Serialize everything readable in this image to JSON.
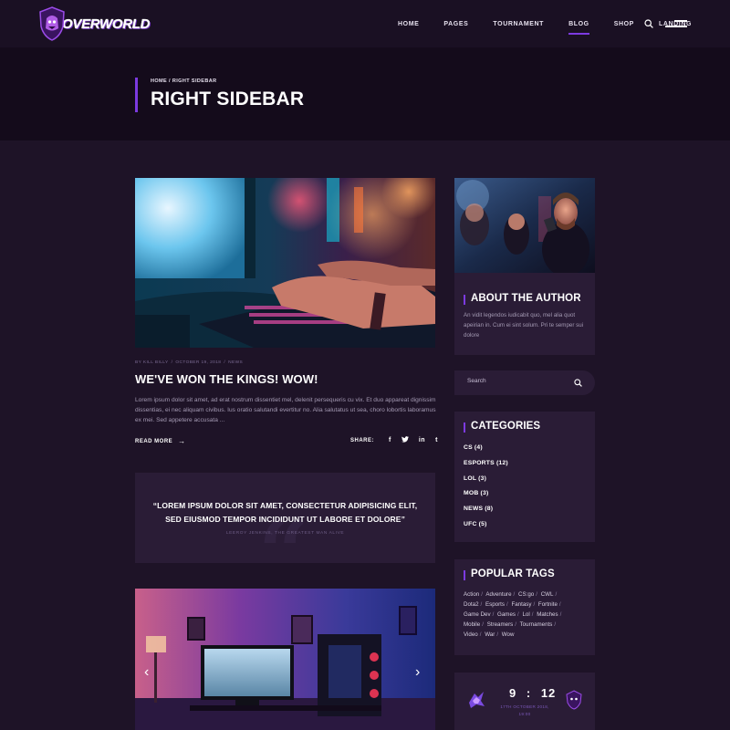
{
  "brand": {
    "name": "OVERWORLD",
    "accent": "#7c3ae0"
  },
  "nav": {
    "items": [
      {
        "label": "HOME",
        "active": false
      },
      {
        "label": "PAGES",
        "active": false
      },
      {
        "label": "TOURNAMENT",
        "active": false
      },
      {
        "label": "BLOG",
        "active": true
      },
      {
        "label": "SHOP",
        "active": false
      },
      {
        "label": "LANDING",
        "active": false
      }
    ],
    "search_icon": "search-icon",
    "menu_icon": "hamburger-icon"
  },
  "header": {
    "breadcrumb": "HOME / RIGHT SIDEBAR",
    "title": "RIGHT SIDEBAR"
  },
  "post": {
    "author": "BY KILL BILLY",
    "date": "OCTOBER 19, 2018",
    "category": "NEWS",
    "title": "WE'VE WON THE KINGS! WOW!",
    "excerpt": "Lorem ipsum dolor sit amet, ad erat nostrum dissentiet mel, delenit persequeris cu vix. Et duo appareat dignissim dissentias, ei nec aliquam civibus. Ius oratio salutandi evertitur no. Alia salutatus ut sea, choro lobortis laboramus ex mei. Sed appetere accusata ...",
    "read_more": "READ MORE",
    "share_label": "SHARE:",
    "social": [
      "f",
      "t",
      "in",
      "t"
    ]
  },
  "quote": {
    "text": "“LOREM IPSUM DOLOR SIT AMET, CONSECTETUR ADIPISICING ELIT, SED EIUSMOD TEMPOR INCIDIDUNT UT LABORE ET DOLORE”",
    "author": "LEEROY JENKINS, THE GREATEST MAN ALIVE"
  },
  "sidebar": {
    "about": {
      "title": "ABOUT THE AUTHOR",
      "text": "An vidit legendos iudicabit quo, mel alia quot apeirian in. Cum ei sint solum. Pri te semper sui dolore"
    },
    "search": {
      "placeholder": "Search"
    },
    "categories": {
      "title": "CATEGORIES",
      "items": [
        "CS (4)",
        "ESPORTS (12)",
        "LOL (3)",
        "MOB (3)",
        "NEWS (8)",
        "UFC (5)"
      ]
    },
    "tags": {
      "title": "POPULAR TAGS",
      "items": [
        "Action",
        "Adventure",
        "CS:go",
        "CWL",
        "Dota2",
        "Esports",
        "Fantasy",
        "Fortnite",
        "Game Dev",
        "Games",
        "Lol",
        "Matches",
        "Mobile",
        "Streamers",
        "Tournaments",
        "Video",
        "War",
        "Wow"
      ]
    },
    "match": {
      "score_left": "9",
      "score_sep": ":",
      "score_right": "12",
      "date": "17TH OCTOBER 2018,",
      "time": "19:00"
    }
  }
}
